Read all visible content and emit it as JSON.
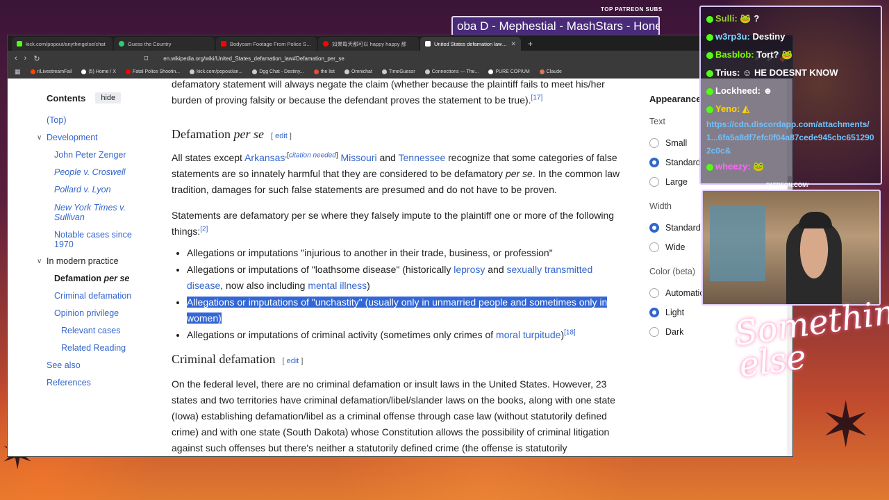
{
  "overlay": {
    "patreon_label": "TOP PATREON SUBS",
    "ticker_text": "oba D - Mephestial - MashStars - Hone",
    "patreon_url": "PATREON.COM/",
    "signature_text": "Something else",
    "cam_signature": "Anything Else"
  },
  "chat": {
    "messages": [
      {
        "user": "Sulli:",
        "text": "?",
        "user_color": "#9acd32"
      },
      {
        "user": "w3rp3u:",
        "text": "Destiny",
        "user_color": "#7fd7ff"
      },
      {
        "user": "Basblob:",
        "text": "Tort?",
        "user_color": "#7cfc00"
      },
      {
        "user": "Trius:",
        "text": "HE DOESNT KNOW",
        "user_color": "#ffffff"
      },
      {
        "user": "Lockheed:",
        "text": "",
        "user_color": "#ffffff"
      },
      {
        "user": "Yeno:",
        "text": "",
        "user_color": "#ffd700"
      },
      {
        "user": "wheezy:",
        "text": "",
        "user_color": "#ff66ff"
      }
    ],
    "link_text": "https://cdn.discordapp.com/attachments/1...6fa5a8df7efc0f04a87cede945cbc6512902c0c&"
  },
  "browser": {
    "tabs": [
      {
        "title": "kick.com/popout/anythingelse/chat",
        "color": "#53fc18",
        "active": false
      },
      {
        "title": "Guess the Country",
        "color": "#2ecc71",
        "active": false
      },
      {
        "title": "Bodycam Footage From Police Shooting",
        "color": "#ff0000",
        "active": false
      },
      {
        "title": "如果每天都可以 happy happy 那",
        "color": "#ff0000",
        "active": false
      },
      {
        "title": "United States defamation law - W",
        "color": "#ffffff",
        "active": true
      }
    ],
    "new_tab": "+",
    "url": "en.wikipedia.org/wiki/United_States_defamation_law#Defamation_per_se",
    "bookmarks": [
      {
        "label": "r/LivestreamFail",
        "color": "#ff4500"
      },
      {
        "label": "(5) Home / X",
        "color": "#ffffff"
      },
      {
        "label": "Fatal Police Shootin...",
        "color": "#ff0000"
      },
      {
        "label": "kick.com/popout/an...",
        "color": "#ffffff"
      },
      {
        "label": "Dgg Chat - Destiny...",
        "color": "#ffffff"
      },
      {
        "label": "the list",
        "color": "#e74c3c"
      },
      {
        "label": "Omnichat",
        "color": "#ffffff"
      },
      {
        "label": "TimeGuessr",
        "color": "#ffffff"
      },
      {
        "label": "Connections — The...",
        "color": "#ffffff"
      },
      {
        "label": "PURE COPIUM",
        "color": "#ffffff"
      },
      {
        "label": "Claude",
        "color": "#d97757"
      }
    ]
  },
  "toc": {
    "title": "Contents",
    "hide": "hide",
    "top": "(Top)",
    "development": "Development",
    "dev_items": [
      "John Peter Zenger",
      "People v. Croswell",
      "Pollard v. Lyon",
      "New York Times v. Sullivan",
      "Notable cases since 1970"
    ],
    "modern": "In modern practice",
    "current_pre": "Defamation ",
    "current_it": "per se",
    "modern_items": [
      "Criminal defamation",
      "Opinion privilege"
    ],
    "sub_items": [
      "Relevant cases",
      "Related Reading"
    ],
    "see_also": "See also",
    "references": "References"
  },
  "article": {
    "intro_top": "defamatory statement will always negate the claim (whether because the plaintiff fails to meet his/her burden of proving falsity or because the defendant proves the statement to be true).",
    "intro_ref": "[17]",
    "h_defamation_pre": "Defamation ",
    "h_defamation_it": "per se",
    "edit_open": "[ ",
    "edit_label": "edit",
    "edit_close": " ]",
    "p1_a": "All states except ",
    "p1_arkansas": "Arkansas",
    "p1_cn_open": ",[",
    "p1_cn": "citation needed",
    "p1_cn_close": "]",
    "p1_missouri": "Missouri",
    "p1_and": " and ",
    "p1_tennessee": "Tennessee",
    "p1_b": " recognize that some categories of false statements are so innately harmful that they are considered to be defamatory ",
    "p1_it": "per se",
    "p1_c": ". In the common law tradition, damages for such false statements are presumed and do not have to be proven.",
    "p2": "Statements are defamatory per se where they falsely impute to the plaintiff one or more of the following things:",
    "p2_ref": "[2]",
    "b1": "Allegations or imputations \"injurious to another in their trade, business, or profession\"",
    "b2_a": "Allegations or imputations of \"loathsome disease\" (historically ",
    "b2_leprosy": "leprosy",
    "b2_and": " and ",
    "b2_std": "sexually transmitted disease",
    "b2_b": ", now also including ",
    "b2_mental": "mental illness",
    "b2_c": ")",
    "b3": "Allegations or imputations of \"unchastity\" (usually only in unmarried people and sometimes only in women)",
    "b4_a": "Allegations or imputations of criminal activity (sometimes only crimes of ",
    "b4_moral": "moral turpitude",
    "b4_b": ")",
    "b4_ref": "[18]",
    "h_criminal": "Criminal defamation",
    "p3": "On the federal level, there are no criminal defamation or insult laws in the United States. However, 23 states and two territories have criminal defamation/libel/slander laws on the books, along with one state (Iowa) establishing defamation/libel as a criminal offense through case law (without statutorily defined crime) and with one state (South Dakota) whose Constitution allows the possibility of criminal litigation against such offenses but there's neither a statutorily defined crime (the offense is statutorily"
  },
  "appearance": {
    "title": "Appearance",
    "text_label": "Text",
    "text_options": [
      "Small",
      "Standard",
      "Large"
    ],
    "text_selected": 1,
    "width_label": "Width",
    "width_options": [
      "Standard",
      "Wide"
    ],
    "width_selected": 0,
    "color_label": "Color (beta)",
    "color_options": [
      "Automatic",
      "Light",
      "Dark"
    ],
    "color_selected": 1
  },
  "colors": {
    "link": "#3366cc",
    "selection": "#3367d6",
    "kick_green": "#53fc18"
  }
}
